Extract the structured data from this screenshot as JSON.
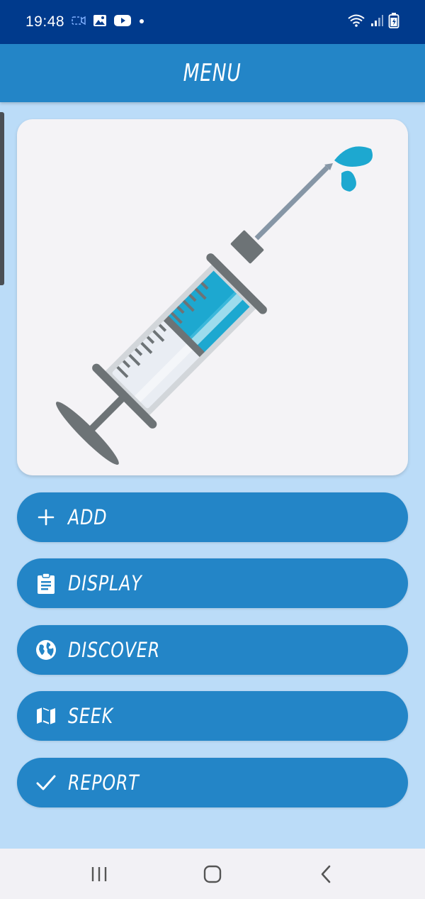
{
  "status_bar": {
    "time": "19:48"
  },
  "app_bar": {
    "title": "MENU"
  },
  "hero": {
    "illustration": "syringe-illustration"
  },
  "menu": {
    "items": [
      {
        "label": "ADD",
        "icon": "plus-icon"
      },
      {
        "label": "DISPLAY",
        "icon": "clipboard-icon"
      },
      {
        "label": "DISCOVER",
        "icon": "globe-icon"
      },
      {
        "label": "SEEK",
        "icon": "map-icon"
      },
      {
        "label": "REPORT",
        "icon": "checkmark-icon"
      }
    ]
  },
  "colors": {
    "status_bar": "#003a8c",
    "app_bar": "#2385c7",
    "background": "#bbdcf8",
    "button": "#2385c7",
    "card": "#f4f3f6",
    "syringe_liquid": "#1da8d0",
    "syringe_gray": "#6d7376"
  },
  "nav_bar": {
    "items": [
      "recents-icon",
      "home-icon",
      "back-icon"
    ]
  }
}
